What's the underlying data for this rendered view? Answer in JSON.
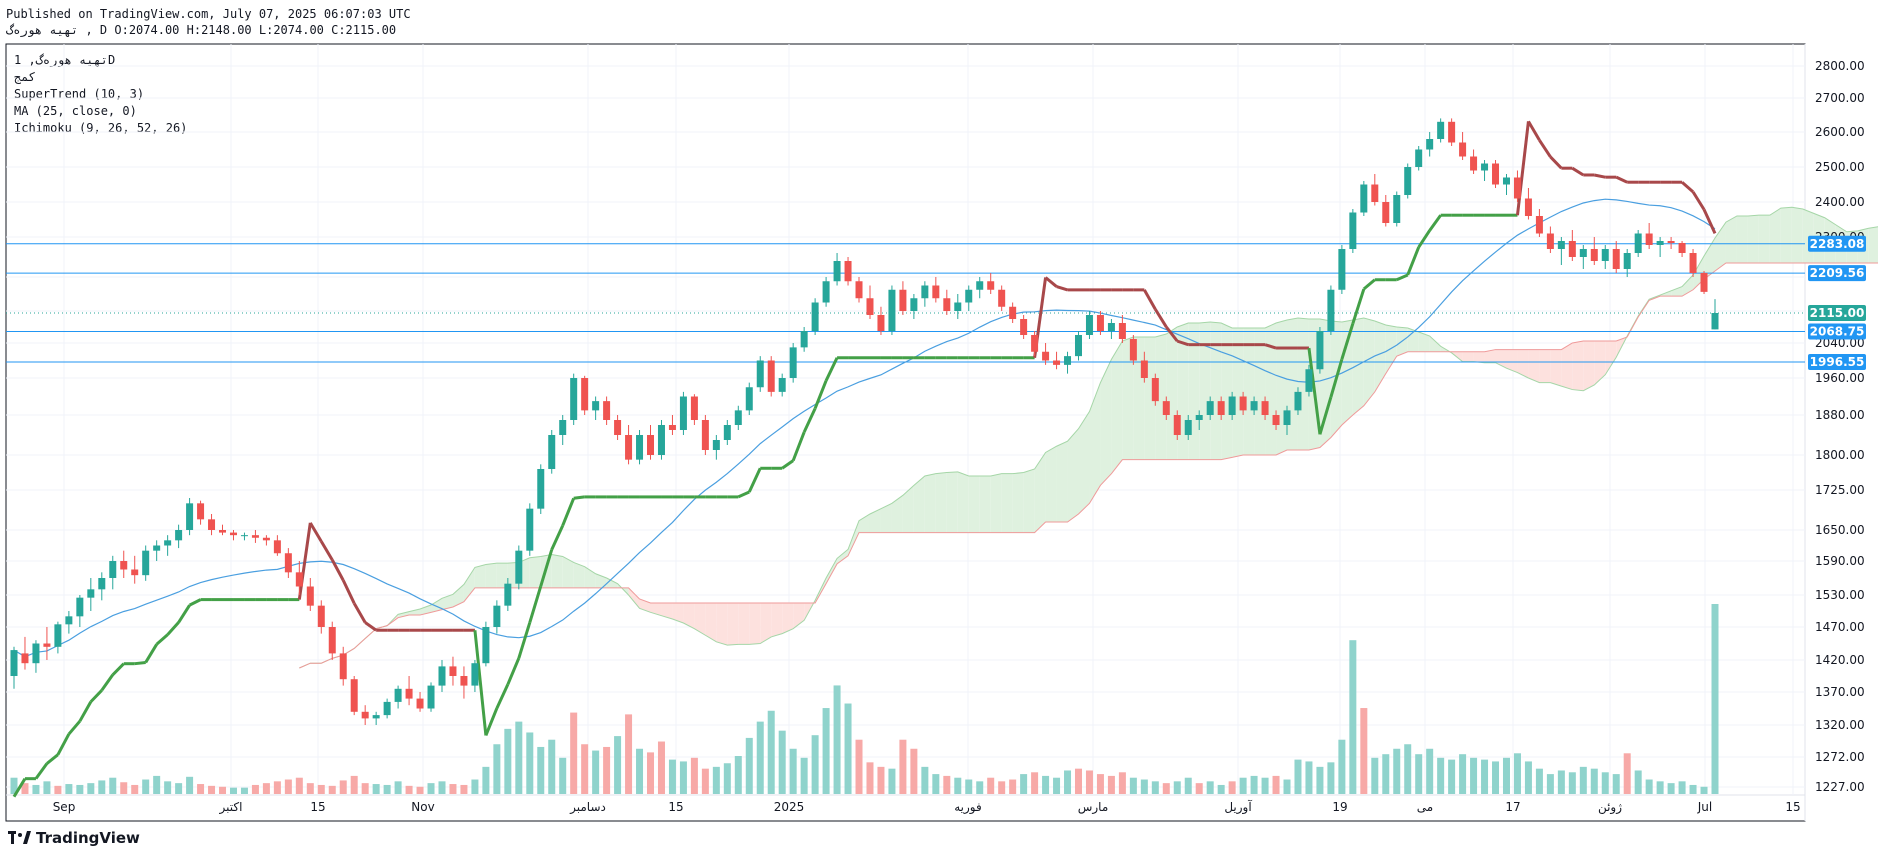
{
  "header": {
    "published": "Published on TradingView.com, July 07, 2025 06:07:03 UTC",
    "ohlc_line": "تهیه هوره‌گ ,  D O:2074.00 H:2148.00 L:2074.00 C:2115.00"
  },
  "legend": {
    "symbol": "تهیه هوره‌گ, 1D",
    "exchange": "کمج",
    "supertrend": "SuperTrend (10, 3)",
    "ma": "MA (25, close, 0)",
    "ichimoku": "Ichimoku (9, 26, 52, 26)"
  },
  "footer": {
    "brand": "TradingView",
    "logo_icon": "tradingview-logo-icon"
  },
  "colors": {
    "up": "#26a69a",
    "down": "#ef5350",
    "up_vol": "#8fd3cc",
    "down_vol": "#f7a9a7",
    "supertrend_up": "#43a047",
    "supertrend_down": "#a8484a",
    "ma": "#4a9fe0",
    "hline": "#2196f3",
    "cloud_bull": "#dff1df",
    "cloud_bear": "#fde1de",
    "last_price_line": "#26a69a"
  },
  "chart_data": {
    "type": "candlestick",
    "y_ticks": [
      "1227.00",
      "1272.00",
      "1320.00",
      "1370.00",
      "1420.00",
      "1470.00",
      "1530.00",
      "1590.00",
      "1650.00",
      "1725.00",
      "1800.00",
      "1880.00",
      "1960.00",
      "2040.00",
      "2120.00",
      "2200.00",
      "2300.00",
      "2400.00",
      "2500.00",
      "2600.00",
      "2700.00",
      "2800.00"
    ],
    "x_labels": [
      "Sep",
      "اکتبر",
      "15",
      "Nov",
      "دسامبر",
      "15",
      "2025",
      "فوریه",
      "مارس",
      "آوریل",
      "19",
      "می",
      "17",
      "ژوئن",
      "Jul",
      "15"
    ],
    "price_tags": [
      {
        "label": "2283.08",
        "value": 2283.08,
        "kind": "hline"
      },
      {
        "label": "2209.56",
        "value": 2209.56,
        "kind": "hline"
      },
      {
        "label": "2115.00",
        "value": 2115.0,
        "kind": "last"
      },
      {
        "label": "2068.75",
        "value": 2068.75,
        "kind": "hline"
      },
      {
        "label": "1996.55",
        "value": 1996.55,
        "kind": "hline"
      }
    ],
    "last_bar": {
      "open": 2074.0,
      "high": 2148.0,
      "low": 2074.0,
      "close": 2115.0
    },
    "candles": [
      [
        1395,
        1440,
        1375,
        1435
      ],
      [
        1430,
        1455,
        1405,
        1415
      ],
      [
        1415,
        1450,
        1400,
        1445
      ],
      [
        1445,
        1470,
        1420,
        1440
      ],
      [
        1440,
        1480,
        1430,
        1475
      ],
      [
        1475,
        1500,
        1460,
        1490
      ],
      [
        1490,
        1530,
        1470,
        1525
      ],
      [
        1525,
        1560,
        1500,
        1540
      ],
      [
        1540,
        1570,
        1520,
        1560
      ],
      [
        1560,
        1600,
        1540,
        1590
      ],
      [
        1590,
        1610,
        1560,
        1575
      ],
      [
        1575,
        1600,
        1550,
        1565
      ],
      [
        1565,
        1620,
        1555,
        1610
      ],
      [
        1610,
        1630,
        1590,
        1620
      ],
      [
        1620,
        1640,
        1600,
        1630
      ],
      [
        1630,
        1660,
        1615,
        1650
      ],
      [
        1650,
        1710,
        1640,
        1700
      ],
      [
        1700,
        1705,
        1660,
        1670
      ],
      [
        1670,
        1680,
        1640,
        1650
      ],
      [
        1650,
        1660,
        1640,
        1645
      ],
      [
        1645,
        1650,
        1630,
        1640
      ],
      [
        1640,
        1645,
        1630,
        1640
      ],
      [
        1640,
        1650,
        1625,
        1635
      ],
      [
        1635,
        1640,
        1620,
        1630
      ],
      [
        1630,
        1640,
        1600,
        1605
      ],
      [
        1605,
        1615,
        1560,
        1570
      ],
      [
        1570,
        1590,
        1530,
        1545
      ],
      [
        1545,
        1560,
        1500,
        1510
      ],
      [
        1510,
        1520,
        1460,
        1470
      ],
      [
        1470,
        1480,
        1420,
        1430
      ],
      [
        1430,
        1440,
        1380,
        1390
      ],
      [
        1390,
        1395,
        1335,
        1340
      ],
      [
        1340,
        1350,
        1320,
        1330
      ],
      [
        1330,
        1340,
        1320,
        1335
      ],
      [
        1335,
        1360,
        1330,
        1355
      ],
      [
        1355,
        1380,
        1345,
        1375
      ],
      [
        1375,
        1395,
        1350,
        1360
      ],
      [
        1360,
        1370,
        1340,
        1345
      ],
      [
        1345,
        1385,
        1340,
        1380
      ],
      [
        1380,
        1420,
        1370,
        1410
      ],
      [
        1410,
        1425,
        1380,
        1395
      ],
      [
        1395,
        1410,
        1360,
        1380
      ],
      [
        1380,
        1420,
        1370,
        1415
      ],
      [
        1415,
        1480,
        1410,
        1470
      ],
      [
        1470,
        1520,
        1460,
        1510
      ],
      [
        1510,
        1560,
        1500,
        1550
      ],
      [
        1550,
        1620,
        1540,
        1610
      ],
      [
        1610,
        1700,
        1600,
        1690
      ],
      [
        1690,
        1780,
        1680,
        1770
      ],
      [
        1770,
        1850,
        1760,
        1840
      ],
      [
        1840,
        1880,
        1820,
        1870
      ],
      [
        1870,
        1970,
        1860,
        1960
      ],
      [
        1960,
        1965,
        1880,
        1890
      ],
      [
        1890,
        1920,
        1870,
        1910
      ],
      [
        1910,
        1920,
        1860,
        1870
      ],
      [
        1870,
        1880,
        1830,
        1840
      ],
      [
        1840,
        1860,
        1780,
        1790
      ],
      [
        1790,
        1850,
        1780,
        1840
      ],
      [
        1840,
        1860,
        1790,
        1800
      ],
      [
        1800,
        1870,
        1790,
        1860
      ],
      [
        1860,
        1880,
        1840,
        1850
      ],
      [
        1850,
        1930,
        1840,
        1920
      ],
      [
        1920,
        1925,
        1860,
        1870
      ],
      [
        1870,
        1880,
        1800,
        1810
      ],
      [
        1810,
        1840,
        1790,
        1830
      ],
      [
        1830,
        1870,
        1820,
        1860
      ],
      [
        1860,
        1900,
        1850,
        1890
      ],
      [
        1890,
        1950,
        1880,
        1940
      ],
      [
        1940,
        2010,
        1930,
        2000
      ],
      [
        2000,
        2010,
        1920,
        1930
      ],
      [
        1930,
        1970,
        1920,
        1960
      ],
      [
        1960,
        2040,
        1950,
        2030
      ],
      [
        2030,
        2080,
        2020,
        2070
      ],
      [
        2070,
        2150,
        2060,
        2140
      ],
      [
        2140,
        2200,
        2130,
        2190
      ],
      [
        2190,
        2260,
        2180,
        2240
      ],
      [
        2240,
        2250,
        2180,
        2190
      ],
      [
        2190,
        2200,
        2140,
        2150
      ],
      [
        2150,
        2180,
        2100,
        2110
      ],
      [
        2110,
        2130,
        2060,
        2070
      ],
      [
        2070,
        2180,
        2060,
        2170
      ],
      [
        2170,
        2190,
        2110,
        2120
      ],
      [
        2120,
        2160,
        2100,
        2150
      ],
      [
        2150,
        2190,
        2130,
        2180
      ],
      [
        2180,
        2200,
        2140,
        2150
      ],
      [
        2150,
        2170,
        2110,
        2120
      ],
      [
        2120,
        2160,
        2100,
        2140
      ],
      [
        2140,
        2180,
        2120,
        2170
      ],
      [
        2170,
        2200,
        2150,
        2190
      ],
      [
        2190,
        2210,
        2160,
        2170
      ],
      [
        2170,
        2180,
        2120,
        2130
      ],
      [
        2130,
        2140,
        2090,
        2100
      ],
      [
        2100,
        2110,
        2050,
        2060
      ],
      [
        2060,
        2070,
        2010,
        2020
      ],
      [
        2020,
        2040,
        1990,
        2000
      ],
      [
        2000,
        2020,
        1980,
        1990
      ],
      [
        1990,
        2020,
        1970,
        2010
      ],
      [
        2010,
        2070,
        2000,
        2060
      ],
      [
        2060,
        2120,
        2050,
        2110
      ],
      [
        2110,
        2120,
        2060,
        2070
      ],
      [
        2070,
        2100,
        2050,
        2090
      ],
      [
        2090,
        2110,
        2040,
        2050
      ],
      [
        2050,
        2060,
        1990,
        2000
      ],
      [
        2000,
        2020,
        1950,
        1960
      ],
      [
        1960,
        1970,
        1900,
        1910
      ],
      [
        1910,
        1920,
        1870,
        1880
      ],
      [
        1880,
        1890,
        1830,
        1840
      ],
      [
        1840,
        1880,
        1830,
        1870
      ],
      [
        1870,
        1890,
        1850,
        1880
      ],
      [
        1880,
        1920,
        1870,
        1910
      ],
      [
        1910,
        1920,
        1870,
        1880
      ],
      [
        1880,
        1930,
        1870,
        1920
      ],
      [
        1920,
        1930,
        1880,
        1890
      ],
      [
        1890,
        1920,
        1880,
        1910
      ],
      [
        1910,
        1920,
        1870,
        1880
      ],
      [
        1880,
        1890,
        1850,
        1860
      ],
      [
        1860,
        1900,
        1840,
        1890
      ],
      [
        1890,
        1940,
        1880,
        1930
      ],
      [
        1930,
        1990,
        1920,
        1980
      ],
      [
        1980,
        2080,
        1970,
        2070
      ],
      [
        2070,
        2180,
        2060,
        2170
      ],
      [
        2170,
        2280,
        2160,
        2270
      ],
      [
        2270,
        2380,
        2260,
        2370
      ],
      [
        2370,
        2460,
        2360,
        2450
      ],
      [
        2450,
        2480,
        2390,
        2400
      ],
      [
        2400,
        2420,
        2330,
        2340
      ],
      [
        2340,
        2430,
        2330,
        2420
      ],
      [
        2420,
        2510,
        2410,
        2500
      ],
      [
        2500,
        2560,
        2490,
        2550
      ],
      [
        2550,
        2600,
        2530,
        2580
      ],
      [
        2580,
        2640,
        2570,
        2630
      ],
      [
        2630,
        2640,
        2560,
        2570
      ],
      [
        2570,
        2600,
        2520,
        2530
      ],
      [
        2530,
        2550,
        2480,
        2490
      ],
      [
        2490,
        2520,
        2460,
        2510
      ],
      [
        2510,
        2520,
        2440,
        2450
      ],
      [
        2450,
        2480,
        2420,
        2470
      ],
      [
        2470,
        2490,
        2400,
        2410
      ],
      [
        2410,
        2440,
        2350,
        2360
      ],
      [
        2360,
        2380,
        2300,
        2310
      ],
      [
        2310,
        2330,
        2260,
        2270
      ],
      [
        2270,
        2300,
        2230,
        2290
      ],
      [
        2290,
        2320,
        2240,
        2250
      ],
      [
        2250,
        2280,
        2220,
        2270
      ],
      [
        2270,
        2300,
        2230,
        2240
      ],
      [
        2240,
        2280,
        2220,
        2270
      ],
      [
        2270,
        2290,
        2210,
        2220
      ],
      [
        2220,
        2270,
        2200,
        2260
      ],
      [
        2260,
        2320,
        2250,
        2310
      ],
      [
        2310,
        2340,
        2270,
        2280
      ],
      [
        2280,
        2300,
        2250,
        2290
      ],
      [
        2290,
        2300,
        2270,
        2285
      ],
      [
        2285,
        2290,
        2250,
        2260
      ],
      [
        2260,
        2270,
        2200,
        2210
      ],
      [
        2210,
        2215,
        2160,
        2165
      ],
      [
        2074,
        2148,
        2074,
        2115
      ]
    ],
    "volume": [
      [
        18,
        1
      ],
      [
        12,
        0
      ],
      [
        10,
        1
      ],
      [
        14,
        1
      ],
      [
        9,
        0
      ],
      [
        11,
        1
      ],
      [
        10,
        1
      ],
      [
        12,
        1
      ],
      [
        15,
        1
      ],
      [
        18,
        1
      ],
      [
        13,
        0
      ],
      [
        10,
        0
      ],
      [
        16,
        1
      ],
      [
        20,
        1
      ],
      [
        14,
        1
      ],
      [
        12,
        1
      ],
      [
        19,
        1
      ],
      [
        11,
        0
      ],
      [
        9,
        0
      ],
      [
        8,
        0
      ],
      [
        7,
        1
      ],
      [
        7,
        1
      ],
      [
        10,
        0
      ],
      [
        12,
        0
      ],
      [
        14,
        0
      ],
      [
        16,
        0
      ],
      [
        18,
        0
      ],
      [
        12,
        0
      ],
      [
        10,
        0
      ],
      [
        9,
        0
      ],
      [
        15,
        0
      ],
      [
        20,
        0
      ],
      [
        12,
        0
      ],
      [
        11,
        1
      ],
      [
        10,
        1
      ],
      [
        14,
        1
      ],
      [
        9,
        0
      ],
      [
        8,
        0
      ],
      [
        12,
        1
      ],
      [
        14,
        1
      ],
      [
        11,
        0
      ],
      [
        10,
        0
      ],
      [
        16,
        1
      ],
      [
        30,
        1
      ],
      [
        55,
        1
      ],
      [
        72,
        1
      ],
      [
        80,
        1
      ],
      [
        68,
        1
      ],
      [
        52,
        1
      ],
      [
        60,
        1
      ],
      [
        40,
        1
      ],
      [
        90,
        0
      ],
      [
        55,
        0
      ],
      [
        48,
        1
      ],
      [
        52,
        0
      ],
      [
        64,
        1
      ],
      [
        88,
        0
      ],
      [
        50,
        1
      ],
      [
        46,
        0
      ],
      [
        58,
        0
      ],
      [
        38,
        1
      ],
      [
        36,
        1
      ],
      [
        40,
        0
      ],
      [
        28,
        0
      ],
      [
        30,
        1
      ],
      [
        34,
        1
      ],
      [
        42,
        1
      ],
      [
        62,
        1
      ],
      [
        80,
        1
      ],
      [
        92,
        1
      ],
      [
        70,
        1
      ],
      [
        50,
        1
      ],
      [
        40,
        1
      ],
      [
        65,
        1
      ],
      [
        95,
        1
      ],
      [
        120,
        1
      ],
      [
        100,
        1
      ],
      [
        60,
        0
      ],
      [
        35,
        0
      ],
      [
        30,
        0
      ],
      [
        28,
        1
      ],
      [
        60,
        0
      ],
      [
        50,
        0
      ],
      [
        30,
        1
      ],
      [
        22,
        1
      ],
      [
        20,
        0
      ],
      [
        18,
        1
      ],
      [
        16,
        1
      ],
      [
        14,
        1
      ],
      [
        18,
        0
      ],
      [
        14,
        0
      ],
      [
        16,
        0
      ],
      [
        22,
        1
      ],
      [
        24,
        0
      ],
      [
        20,
        1
      ],
      [
        18,
        1
      ],
      [
        26,
        1
      ],
      [
        28,
        0
      ],
      [
        26,
        0
      ],
      [
        22,
        0
      ],
      [
        20,
        0
      ],
      [
        24,
        0
      ],
      [
        18,
        1
      ],
      [
        16,
        1
      ],
      [
        14,
        1
      ],
      [
        12,
        0
      ],
      [
        14,
        1
      ],
      [
        18,
        1
      ],
      [
        12,
        0
      ],
      [
        14,
        1
      ],
      [
        10,
        1
      ],
      [
        14,
        0
      ],
      [
        18,
        1
      ],
      [
        20,
        1
      ],
      [
        18,
        1
      ],
      [
        20,
        0
      ],
      [
        16,
        1
      ],
      [
        38,
        1
      ],
      [
        36,
        1
      ],
      [
        30,
        1
      ],
      [
        35,
        1
      ],
      [
        60,
        1
      ],
      [
        170,
        1
      ],
      [
        95,
        0
      ],
      [
        40,
        1
      ],
      [
        44,
        1
      ],
      [
        50,
        1
      ],
      [
        55,
        1
      ],
      [
        44,
        1
      ],
      [
        50,
        1
      ],
      [
        40,
        1
      ],
      [
        38,
        1
      ],
      [
        44,
        1
      ],
      [
        40,
        1
      ],
      [
        38,
        1
      ],
      [
        36,
        1
      ],
      [
        40,
        1
      ],
      [
        45,
        1
      ],
      [
        36,
        1
      ],
      [
        28,
        1
      ],
      [
        22,
        1
      ],
      [
        26,
        1
      ],
      [
        24,
        1
      ],
      [
        30,
        1
      ],
      [
        28,
        1
      ],
      [
        24,
        1
      ],
      [
        22,
        1
      ],
      [
        45,
        0
      ],
      [
        26,
        1
      ],
      [
        16,
        1
      ],
      [
        14,
        1
      ],
      [
        12,
        1
      ],
      [
        14,
        1
      ],
      [
        10,
        1
      ],
      [
        8,
        1
      ],
      [
        210,
        1
      ]
    ]
  }
}
